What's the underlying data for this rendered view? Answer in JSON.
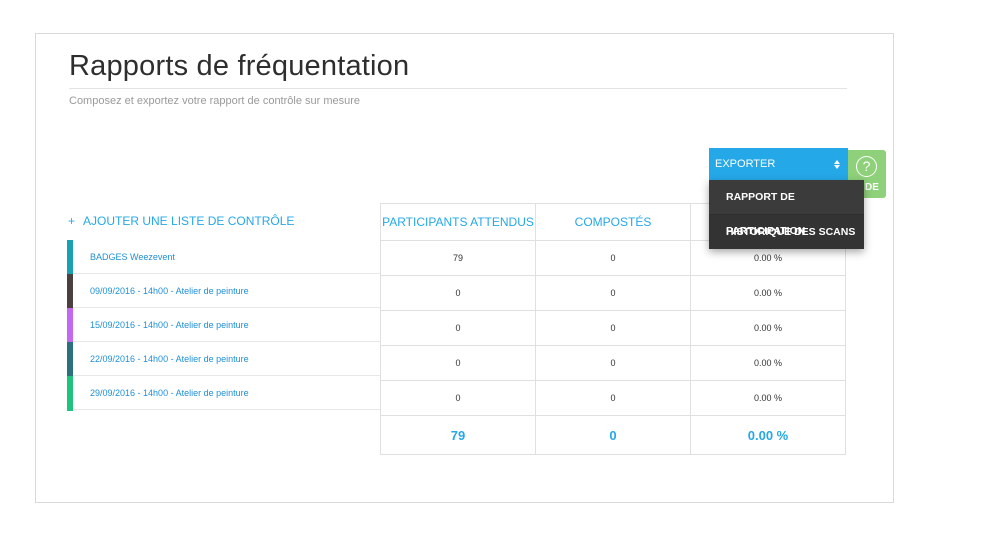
{
  "header": {
    "title": "Rapports de fréquentation",
    "subtitle": "Composez et exportez votre rapport de contrôle sur mesure"
  },
  "export": {
    "label": "EXPORTER",
    "menu": [
      "RAPPORT DE PARTICIPATION",
      "HISTORIQUE DES SCANS"
    ]
  },
  "help": {
    "label": "DE",
    "icon": "question-icon"
  },
  "add_list": {
    "plus": "+",
    "label": "AJOUTER UNE LISTE DE CONTRÔLE"
  },
  "table": {
    "columns": [
      "PARTICIPANTS ATTENDUS",
      "COMPOSTÉS",
      ""
    ],
    "rows": [
      {
        "name": "BADGES Weezevent",
        "color": "#1aa0b3",
        "expected": "79",
        "scanned": "0",
        "rate": "0.00 %"
      },
      {
        "name": "09/09/2016 - 14h00 - Atelier de peinture",
        "color": "#4a4040",
        "expected": "0",
        "scanned": "0",
        "rate": "0.00 %"
      },
      {
        "name": "15/09/2016 - 14h00 - Atelier de peinture",
        "color": "#c468f2",
        "expected": "0",
        "scanned": "0",
        "rate": "0.00 %"
      },
      {
        "name": "22/09/2016 - 14h00 - Atelier de peinture",
        "color": "#2d6f7d",
        "expected": "0",
        "scanned": "0",
        "rate": "0.00 %"
      },
      {
        "name": "29/09/2016 - 14h00 - Atelier de peinture",
        "color": "#1ec47e",
        "expected": "0",
        "scanned": "0",
        "rate": "0.00 %"
      }
    ],
    "totals": {
      "expected": "79",
      "scanned": "0",
      "rate": "0.00 %"
    }
  },
  "colors": {
    "accent": "#25a8e8",
    "help": "#8fd17b",
    "menu": "#3b3b3b"
  }
}
